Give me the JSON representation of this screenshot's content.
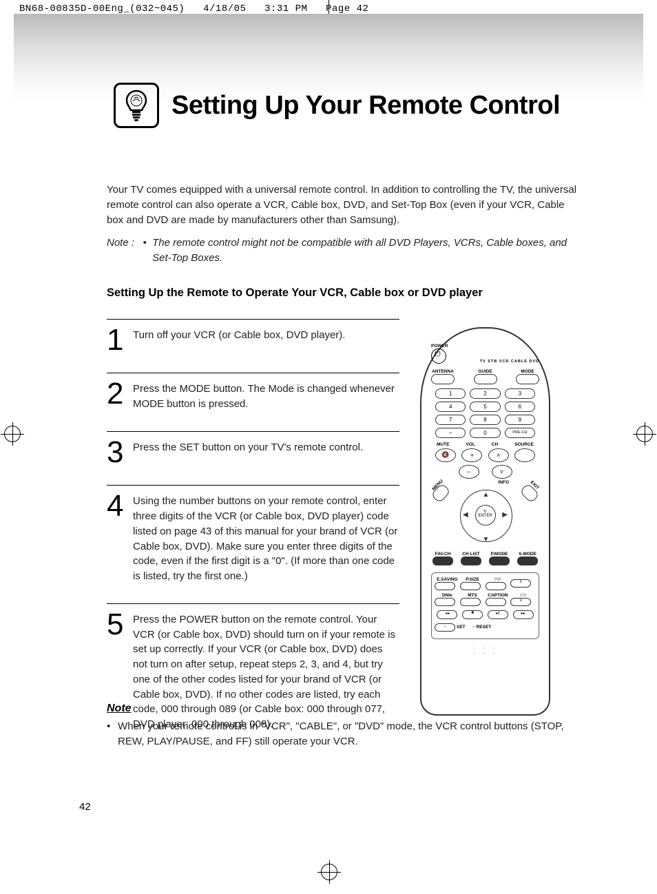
{
  "meta": {
    "doc_id": "BN68-00835D-00Eng_(032~045)",
    "date": "4/18/05",
    "time": "3:31 PM",
    "page_tag": "Page 42"
  },
  "title": "Setting Up Your Remote Control",
  "intro": "Your TV comes equipped with a universal remote control. In addition to controlling the TV, the universal remote control can also operate a VCR, Cable box, DVD, and Set-Top Box (even if your VCR, Cable box and DVD are made by manufacturers other than Samsung).",
  "note_prefix": "Note :   •  ",
  "note_text": "The remote control might not be compatible with all DVD Players, VCRs, Cable boxes, and Set-Top Boxes.",
  "subhead": "Setting Up the Remote to Operate Your VCR, Cable box or DVD player",
  "steps": [
    {
      "num": "1",
      "text": "Turn off your VCR (or Cable box, DVD player)."
    },
    {
      "num": "2",
      "text": "Press the MODE button. The Mode is changed whenever MODE button is pressed."
    },
    {
      "num": "3",
      "text": "Press the SET button on your TV's remote control."
    },
    {
      "num": "4",
      "text": "Using the number buttons on your remote control, enter three digits of the VCR (or Cable box, DVD player) code listed on page 43 of this manual for your brand of VCR (or Cable box, DVD). Make sure you enter three digits of the code, even if the first digit is a \"0\". (If more than one code is listed, try the first one.)"
    },
    {
      "num": "5",
      "text": "Press the POWER button on the remote control. Your VCR (or Cable box, DVD) should turn on if your remote is set up correctly. If your VCR (or Cable box, DVD) does not turn on after setup, repeat steps 2, 3, and 4, but try one of the other codes listed for your brand of VCR (or Cable box, DVD). If no other codes are listed, try each code, 000 through 089 (or Cable box: 000 through 077, DVD player: 000 through 008)."
    }
  ],
  "footer_note": {
    "heading": "Note",
    "bullet": "When your remote control is in \"VCR\", \"CABLE\", or \"DVD\" mode, the VCR control buttons (STOP, REW, PLAY/PAUSE, and FF) still operate your VCR."
  },
  "page_number": "42",
  "remote": {
    "power": "POWER",
    "mode_strip": "TV  STB  VCR  CABLE  DVD",
    "row2": {
      "antenna": "ANTENNA",
      "guide": "GUIDE",
      "mode": "MODE"
    },
    "numbers": [
      "1",
      "2",
      "3",
      "4",
      "5",
      "6",
      "7",
      "8",
      "9",
      "–",
      "0",
      "PRE-CH"
    ],
    "vol": "VOL",
    "ch": "CH",
    "mute": "MUTE",
    "source": "SOURCE",
    "menu": "MENU",
    "info": "INFO",
    "exit": "EXIT",
    "enter": "ENTER",
    "row_small": [
      "FAV.CH",
      "CH LIST",
      "P.MODE",
      "S.MODE"
    ],
    "grid2": [
      "E.SAVING",
      "P.SIZE",
      "PIP",
      "",
      "DNIe",
      "MTS",
      "CAPTION",
      "CH"
    ],
    "set": "SET",
    "reset": "RESET"
  }
}
